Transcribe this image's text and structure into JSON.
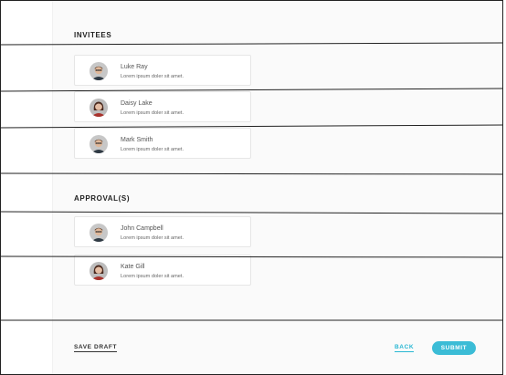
{
  "invitees": {
    "title": "INVITEES",
    "people": [
      {
        "name": "Luke Ray",
        "desc": "Lorem ipsum doler sit amet."
      },
      {
        "name": "Daisy Lake",
        "desc": "Lorem ipsum doler sit amet."
      },
      {
        "name": "Mark Smith",
        "desc": "Lorem ipsum doler sit amet."
      }
    ]
  },
  "approvals": {
    "title": "APPROVAL(S)",
    "people": [
      {
        "name": "John Campbell",
        "desc": "Lorem ipsum doler sit amet."
      },
      {
        "name": "Kate Gill",
        "desc": "Lorem ipsum doler sit amet."
      }
    ]
  },
  "footer": {
    "save_draft": "SAVE DRAFT",
    "back": "BACK",
    "submit": "SUBMIT"
  },
  "colors": {
    "accent": "#3bbcd6",
    "panel_bg": "#fafafa"
  }
}
